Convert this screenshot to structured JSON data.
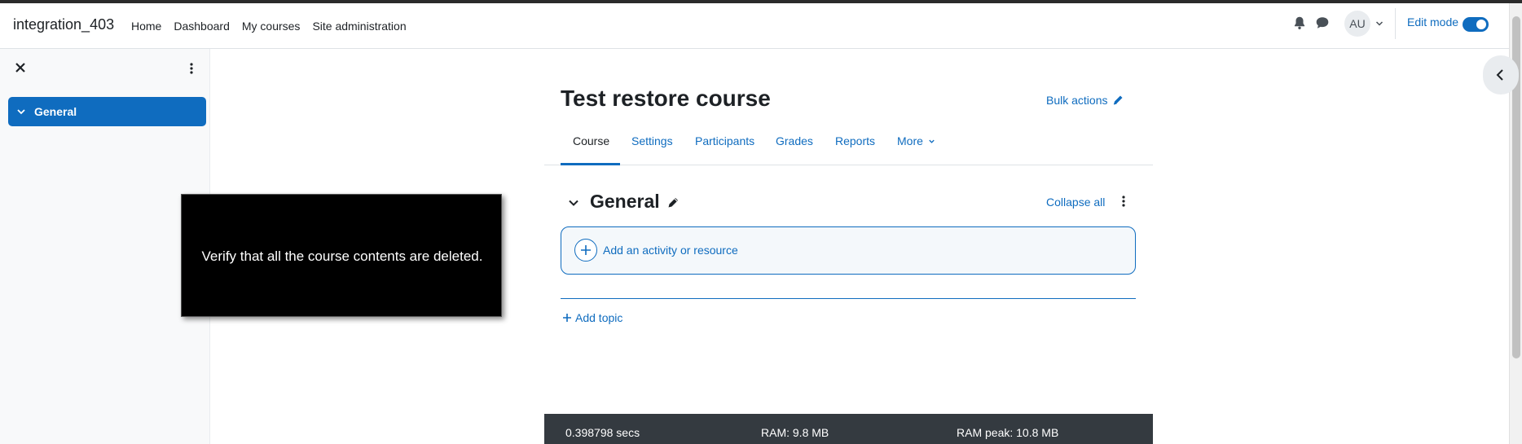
{
  "header": {
    "site_name": "integration_403",
    "nav": [
      "Home",
      "Dashboard",
      "My courses",
      "Site administration"
    ],
    "avatar_initials": "AU",
    "edit_mode_label": "Edit mode",
    "edit_mode_on": true
  },
  "drawer": {
    "items": [
      {
        "label": "General",
        "expanded": true
      }
    ]
  },
  "main": {
    "title": "Test restore course",
    "bulk_actions": "Bulk actions",
    "tabs": [
      "Course",
      "Settings",
      "Participants",
      "Grades",
      "Reports",
      "More"
    ],
    "active_tab": "Course",
    "section": {
      "title": "General",
      "collapse_all": "Collapse all",
      "add_activity": "Add an activity or resource"
    },
    "add_topic": "Add topic"
  },
  "overlay": {
    "message": "Verify that all the course contents are deleted."
  },
  "footer": {
    "time": "0.398798 secs",
    "ram": "RAM: 9.8 MB",
    "ram_peak": "RAM peak: 10.8 MB"
  },
  "colors": {
    "primary": "#0f6cbf",
    "footer_bg": "#343a40",
    "overlay_bg": "#000000"
  }
}
